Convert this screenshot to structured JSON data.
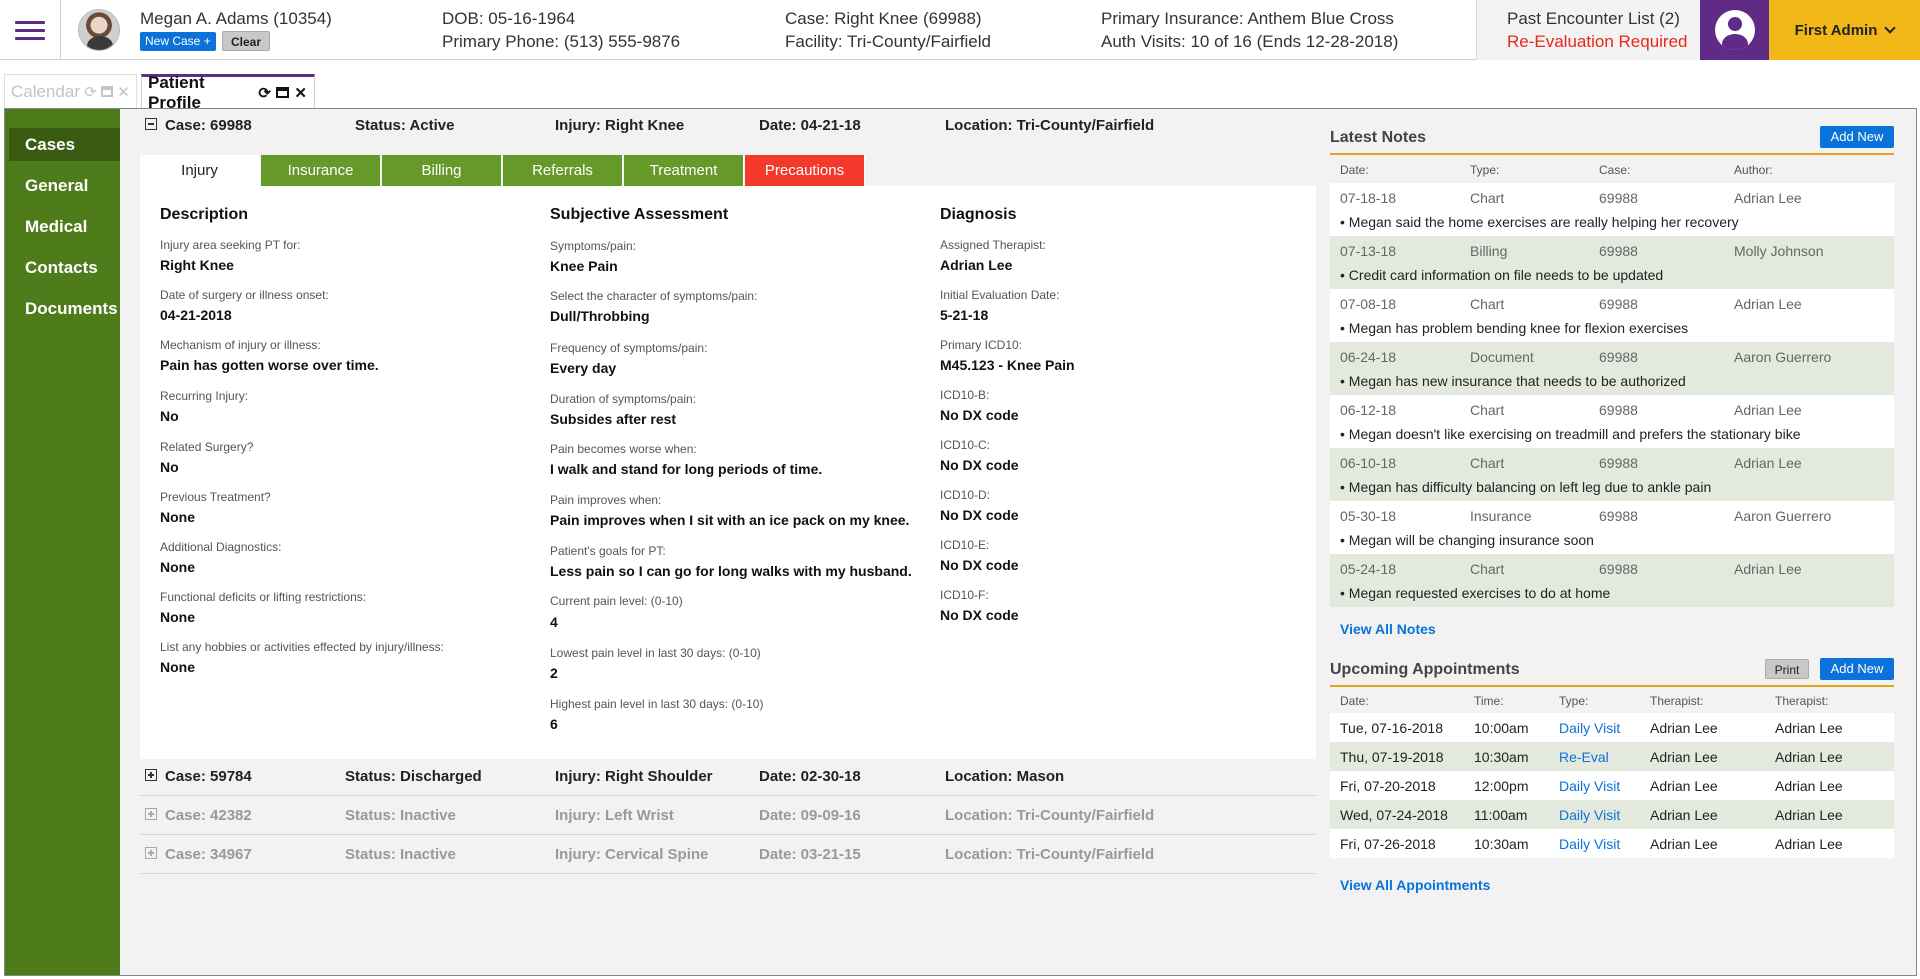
{
  "header": {
    "patient_name": "Megan A. Adams (10354)",
    "new_case_label": "New Case +",
    "clear_label": "Clear",
    "dob": "DOB: 05-16-1964",
    "phone": "Primary Phone: (513) 555-9876",
    "case": "Case: Right Knee (69988)",
    "facility": "Facility: Tri-County/Fairfield",
    "insurance": "Primary Insurance: Anthem Blue Cross",
    "auth_visits": "Auth Visits: 10 of 16 (Ends 12-28-2018)",
    "past_encounter": "Past Encounter List (2)",
    "reeval": "Re-Evaluation Required",
    "user_label": "First Admin"
  },
  "tabs": [
    {
      "label": "Calendar"
    },
    {
      "label": "Patient Profile"
    }
  ],
  "sidebar": {
    "items": [
      {
        "label": "Cases"
      },
      {
        "label": "General"
      },
      {
        "label": "Medical"
      },
      {
        "label": "Contacts"
      },
      {
        "label": "Documents"
      }
    ]
  },
  "active_case": {
    "case": "Case: 69988",
    "status": "Status: Active",
    "injury": "Injury: Right Knee",
    "date": "Date: 04-21-18",
    "location": "Location: Tri-County/Fairfield",
    "tabs": [
      {
        "label": "Injury"
      },
      {
        "label": "Insurance"
      },
      {
        "label": "Billing"
      },
      {
        "label": "Referrals"
      },
      {
        "label": "Treatment"
      },
      {
        "label": "Precautions"
      }
    ],
    "description": {
      "title": "Description",
      "fields": [
        {
          "label": "Injury area seeking PT for:",
          "value": "Right Knee"
        },
        {
          "label": "Date of surgery or illness onset:",
          "value": "04-21-2018"
        },
        {
          "label": "Mechanism of injury or illness:",
          "value": "Pain has gotten worse over time."
        },
        {
          "label": "Recurring Injury:",
          "value": "No"
        },
        {
          "label": "Related Surgery?",
          "value": "No"
        },
        {
          "label": "Previous Treatment?",
          "value": "None"
        },
        {
          "label": "Additional Diagnostics:",
          "value": "None"
        },
        {
          "label": "Functional deficits or lifting restrictions:",
          "value": "None"
        },
        {
          "label": "List any hobbies or activities effected by injury/illness:",
          "value": "None"
        }
      ]
    },
    "subjective": {
      "title": "Subjective Assessment",
      "fields": [
        {
          "label": "Symptoms/pain:",
          "value": "Knee Pain"
        },
        {
          "label": "Select the character of symptoms/pain:",
          "value": "Dull/Throbbing"
        },
        {
          "label": "Frequency of symptoms/pain:",
          "value": "Every day"
        },
        {
          "label": "Duration of symptoms/pain:",
          "value": "Subsides after rest"
        },
        {
          "label": "Pain becomes worse when:",
          "value": "I walk and stand for long periods of time."
        },
        {
          "label": "Pain improves when:",
          "value": "Pain improves when I sit with an ice pack on my knee."
        },
        {
          "label": "Patient's goals for PT:",
          "value": "Less pain so I can go for long walks with my husband."
        },
        {
          "label": "Current pain level: (0-10)",
          "value": "4"
        },
        {
          "label": "Lowest pain level in last 30 days: (0-10)",
          "value": "2"
        },
        {
          "label": "Highest pain level in last 30 days: (0-10)",
          "value": "6"
        }
      ]
    },
    "diagnosis": {
      "title": "Diagnosis",
      "fields": [
        {
          "label": "Assigned Therapist:",
          "value": "Adrian Lee"
        },
        {
          "label": "Initial Evaluation Date:",
          "value": "5-21-18"
        },
        {
          "label": "Primary ICD10:",
          "value": "M45.123 - Knee Pain"
        },
        {
          "label": "ICD10-B:",
          "value": "No DX code"
        },
        {
          "label": "ICD10-C:",
          "value": "No DX code"
        },
        {
          "label": "ICD10-D:",
          "value": "No DX code"
        },
        {
          "label": "ICD10-E:",
          "value": "No DX code"
        },
        {
          "label": "ICD10-F:",
          "value": "No DX code"
        }
      ]
    }
  },
  "other_cases": [
    {
      "case": "Case: 59784",
      "status": "Status: Discharged",
      "injury": "Injury: Right Shoulder",
      "date": "Date: 02-30-18",
      "location": "Location: Mason"
    },
    {
      "case": "Case: 42382",
      "status": "Status: Inactive",
      "injury": "Injury: Left Wrist",
      "date": "Date: 09-09-16",
      "location": "Location: Tri-County/Fairfield"
    },
    {
      "case": "Case: 34967",
      "status": "Status: Inactive",
      "injury": "Injury: Cervical Spine",
      "date": "Date: 03-21-15",
      "location": "Location: Tri-County/Fairfield"
    }
  ],
  "notes": {
    "title": "Latest Notes",
    "add_label": "Add New",
    "columns": [
      "Date:",
      "Type:",
      "Case:",
      "Author:"
    ],
    "rows": [
      {
        "date": "07-18-18",
        "type": "Chart",
        "case": "69988",
        "author": "Adrian Lee",
        "text": "• Megan said the home exercises are really helping her recovery"
      },
      {
        "date": "07-13-18",
        "type": "Billing",
        "case": "69988",
        "author": "Molly Johnson",
        "text": "• Credit card information on file needs to be updated"
      },
      {
        "date": "07-08-18",
        "type": "Chart",
        "case": "69988",
        "author": "Adrian Lee",
        "text": "• Megan has problem bending knee for flexion exercises"
      },
      {
        "date": "06-24-18",
        "type": "Document",
        "case": "69988",
        "author": "Aaron Guerrero",
        "text": "• Megan has new insurance that needs to be authorized"
      },
      {
        "date": "06-12-18",
        "type": "Chart",
        "case": "69988",
        "author": "Adrian Lee",
        "text": "• Megan doesn't like exercising on treadmill and prefers the stationary bike"
      },
      {
        "date": "06-10-18",
        "type": "Chart",
        "case": "69988",
        "author": "Adrian Lee",
        "text": "• Megan has difficulty balancing on left leg due to ankle pain"
      },
      {
        "date": "05-30-18",
        "type": "Insurance",
        "case": "69988",
        "author": "Aaron Guerrero",
        "text": "• Megan will be changing insurance soon"
      },
      {
        "date": "05-24-18",
        "type": "Chart",
        "case": "69988",
        "author": "Adrian Lee",
        "text": "• Megan requested exercises to do at home"
      }
    ],
    "view_all": "View All Notes"
  },
  "appointments": {
    "title": "Upcoming Appointments",
    "print_label": "Print",
    "add_label": "Add New",
    "columns": [
      "Date:",
      "Time:",
      "Type:",
      "Therapist:",
      "Therapist:"
    ],
    "rows": [
      {
        "date": "Tue, 07-16-2018",
        "time": "10:00am",
        "type": "Daily Visit",
        "therapist": "Adrian Lee",
        "therapist2": "Adrian Lee"
      },
      {
        "date": "Thu, 07-19-2018",
        "time": "10:30am",
        "type": "Re-Eval",
        "therapist": "Adrian Lee",
        "therapist2": "Adrian Lee"
      },
      {
        "date": "Fri, 07-20-2018",
        "time": "12:00pm",
        "type": "Daily Visit",
        "therapist": "Adrian Lee",
        "therapist2": "Adrian Lee"
      },
      {
        "date": "Wed, 07-24-2018",
        "time": "11:00am",
        "type": "Daily Visit",
        "therapist": "Adrian Lee",
        "therapist2": "Adrian Lee"
      },
      {
        "date": "Fri, 07-26-2018",
        "time": "10:30am",
        "type": "Daily Visit",
        "therapist": "Adrian Lee",
        "therapist2": "Adrian Lee"
      }
    ],
    "view_all": "View All Appointments"
  },
  "colors": {
    "brand_purple": "#5f2b87",
    "nav_green": "#4f7c1a",
    "tab_green": "#65992a",
    "alert_red": "#f2392c",
    "accent_gold": "#f2b818",
    "link_blue": "#0a72d8"
  }
}
